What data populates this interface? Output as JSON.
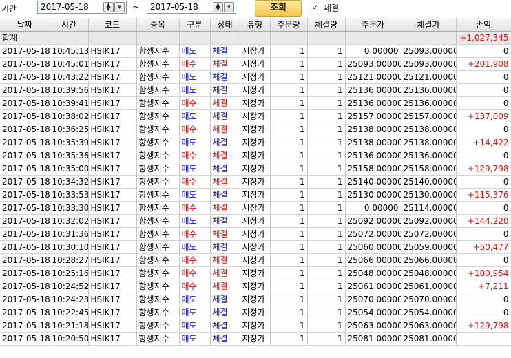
{
  "filter": {
    "period_label": "기간",
    "start_date": "2017-05-18",
    "tilde": "~",
    "end_date": "2017-05-18",
    "search_label": "조회",
    "filled_checked": true,
    "filled_label": "체결"
  },
  "table": {
    "headers": [
      "날짜",
      "시간",
      "코드",
      "종목",
      "구분",
      "상태",
      "유형",
      "주문량",
      "체결량",
      "주문가",
      "체결가",
      "손익"
    ],
    "summary": {
      "label": "합계",
      "pnl": "+1,027,345"
    },
    "rows": [
      {
        "date": "2017-05-18",
        "time": "10:45:13",
        "code": "HSIK17",
        "name": "항셍지수",
        "side": "매도",
        "status": "체결",
        "type": "시장가",
        "qty": "1",
        "filled": "1",
        "order_price": "0.00000",
        "fill_price": "25093.00000",
        "pnl": "0"
      },
      {
        "date": "2017-05-18",
        "time": "10:45:01",
        "code": "HSIK17",
        "name": "항셍지수",
        "side": "매수",
        "status": "체결",
        "type": "지정가",
        "qty": "1",
        "filled": "1",
        "order_price": "25093.00000",
        "fill_price": "25093.00000",
        "pnl": "+201,908"
      },
      {
        "date": "2017-05-18",
        "time": "10:43:22",
        "code": "HSIK17",
        "name": "항셍지수",
        "side": "매도",
        "status": "체결",
        "type": "지정가",
        "qty": "1",
        "filled": "1",
        "order_price": "25121.00000",
        "fill_price": "25121.00000",
        "pnl": "0"
      },
      {
        "date": "2017-05-18",
        "time": "10:39:56",
        "code": "HSIK17",
        "name": "항셍지수",
        "side": "매도",
        "status": "체결",
        "type": "지정가",
        "qty": "1",
        "filled": "1",
        "order_price": "25136.00000",
        "fill_price": "25136.00000",
        "pnl": "0"
      },
      {
        "date": "2017-05-18",
        "time": "10:39:41",
        "code": "HSIK17",
        "name": "항셍지수",
        "side": "매수",
        "status": "체결",
        "type": "지정가",
        "qty": "1",
        "filled": "1",
        "order_price": "25136.00000",
        "fill_price": "25136.00000",
        "pnl": "0"
      },
      {
        "date": "2017-05-18",
        "time": "10:38:02",
        "code": "HSIK17",
        "name": "항셍지수",
        "side": "매도",
        "status": "체결",
        "type": "시장가",
        "qty": "1",
        "filled": "1",
        "order_price": "25157.00000",
        "fill_price": "25157.00000",
        "pnl": "+137,009"
      },
      {
        "date": "2017-05-18",
        "time": "10:36:25",
        "code": "HSIK17",
        "name": "항셍지수",
        "side": "매수",
        "status": "체결",
        "type": "지정가",
        "qty": "1",
        "filled": "1",
        "order_price": "25138.00000",
        "fill_price": "25138.00000",
        "pnl": "0"
      },
      {
        "date": "2017-05-18",
        "time": "10:35:39",
        "code": "HSIK17",
        "name": "항셍지수",
        "side": "매도",
        "status": "체결",
        "type": "지정가",
        "qty": "1",
        "filled": "1",
        "order_price": "25138.00000",
        "fill_price": "25138.00000",
        "pnl": "+14,422"
      },
      {
        "date": "2017-05-18",
        "time": "10:35:36",
        "code": "HSIK17",
        "name": "항셍지수",
        "side": "매수",
        "status": "체결",
        "type": "지정가",
        "qty": "1",
        "filled": "1",
        "order_price": "25136.00000",
        "fill_price": "25136.00000",
        "pnl": "0"
      },
      {
        "date": "2017-05-18",
        "time": "10:35:00",
        "code": "HSIK17",
        "name": "항셍지수",
        "side": "매도",
        "status": "체결",
        "type": "지정가",
        "qty": "1",
        "filled": "1",
        "order_price": "25158.00000",
        "fill_price": "25158.00000",
        "pnl": "+129,798"
      },
      {
        "date": "2017-05-18",
        "time": "10:34:32",
        "code": "HSIK17",
        "name": "항셍지수",
        "side": "매수",
        "status": "체결",
        "type": "지정가",
        "qty": "1",
        "filled": "1",
        "order_price": "25140.00000",
        "fill_price": "25140.00000",
        "pnl": "0"
      },
      {
        "date": "2017-05-18",
        "time": "10:33:53",
        "code": "HSIK17",
        "name": "항셍지수",
        "side": "매도",
        "status": "체결",
        "type": "지정가",
        "qty": "1",
        "filled": "1",
        "order_price": "25130.00000",
        "fill_price": "25130.00000",
        "pnl": "+115,376"
      },
      {
        "date": "2017-05-18",
        "time": "10:33:30",
        "code": "HSIK17",
        "name": "항셍지수",
        "side": "매수",
        "status": "체결",
        "type": "시장가",
        "qty": "1",
        "filled": "1",
        "order_price": "0.00000",
        "fill_price": "25114.00000",
        "pnl": "0"
      },
      {
        "date": "2017-05-18",
        "time": "10:32:02",
        "code": "HSIK17",
        "name": "항셍지수",
        "side": "매도",
        "status": "체결",
        "type": "지정가",
        "qty": "1",
        "filled": "1",
        "order_price": "25092.00000",
        "fill_price": "25092.00000",
        "pnl": "+144,220"
      },
      {
        "date": "2017-05-18",
        "time": "10:31:36",
        "code": "HSIK17",
        "name": "항셍지수",
        "side": "매수",
        "status": "체결",
        "type": "지정가",
        "qty": "1",
        "filled": "1",
        "order_price": "25072.00000",
        "fill_price": "25072.00000",
        "pnl": "0"
      },
      {
        "date": "2017-05-18",
        "time": "10:30:10",
        "code": "HSIK17",
        "name": "항셍지수",
        "side": "매도",
        "status": "체결",
        "type": "시장가",
        "qty": "1",
        "filled": "1",
        "order_price": "25060.00000",
        "fill_price": "25059.00000",
        "pnl": "+50,477"
      },
      {
        "date": "2017-05-18",
        "time": "10:28:27",
        "code": "HSIK17",
        "name": "항셍지수",
        "side": "매수",
        "status": "체결",
        "type": "지정가",
        "qty": "1",
        "filled": "1",
        "order_price": "25066.00000",
        "fill_price": "25066.00000",
        "pnl": "0"
      },
      {
        "date": "2017-05-18",
        "time": "10:25:16",
        "code": "HSIK17",
        "name": "항셍지수",
        "side": "매수",
        "status": "체결",
        "type": "지정가",
        "qty": "1",
        "filled": "1",
        "order_price": "25048.00000",
        "fill_price": "25048.00000",
        "pnl": "+100,954"
      },
      {
        "date": "2017-05-18",
        "time": "10:24:52",
        "code": "HSIK17",
        "name": "항셍지수",
        "side": "매수",
        "status": "체결",
        "type": "지정가",
        "qty": "1",
        "filled": "1",
        "order_price": "25061.00000",
        "fill_price": "25061.00000",
        "pnl": "+7,211"
      },
      {
        "date": "2017-05-18",
        "time": "10:24:23",
        "code": "HSIK17",
        "name": "항셍지수",
        "side": "매도",
        "status": "체결",
        "type": "지정가",
        "qty": "1",
        "filled": "1",
        "order_price": "25070.00000",
        "fill_price": "25070.00000",
        "pnl": "0"
      },
      {
        "date": "2017-05-18",
        "time": "10:22:45",
        "code": "HSIK17",
        "name": "항셍지수",
        "side": "매도",
        "status": "체결",
        "type": "지정가",
        "qty": "1",
        "filled": "1",
        "order_price": "25054.00000",
        "fill_price": "25054.00000",
        "pnl": "0"
      },
      {
        "date": "2017-05-18",
        "time": "10:21:18",
        "code": "HSIK17",
        "name": "항셍지수",
        "side": "매도",
        "status": "체결",
        "type": "지정가",
        "qty": "1",
        "filled": "1",
        "order_price": "25063.00000",
        "fill_price": "25063.00000",
        "pnl": "+129,798"
      },
      {
        "date": "2017-05-18",
        "time": "10:20:50",
        "code": "HSIK17",
        "name": "항셍지수",
        "side": "매도",
        "status": "체결",
        "type": "지정가",
        "qty": "1",
        "filled": "1",
        "order_price": "25081.00000",
        "fill_price": "25081.00000",
        "pnl": ""
      }
    ]
  },
  "colors": {
    "buy": "#e01010",
    "sell": "#1010e0",
    "search_button": "#f5c44a"
  },
  "icons": {
    "spin": "spin-updown-icon",
    "dropdown": "dropdown-arrow-icon",
    "checkbox": "checkmark-icon"
  }
}
